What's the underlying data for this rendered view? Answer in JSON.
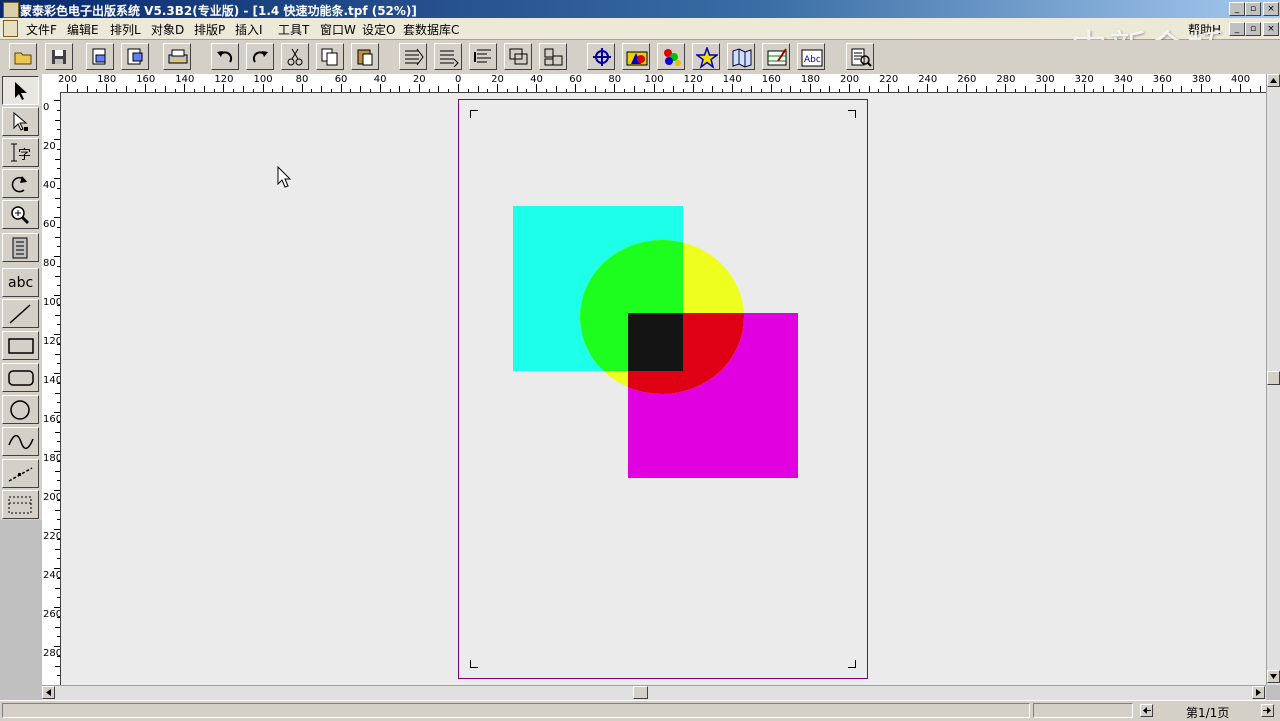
{
  "window": {
    "title": "蒙泰彩色电子出版系统 V5.3B2(专业版) - [1.4 快速功能条.tpf (52%)]",
    "help_menu": "帮助H"
  },
  "menu": [
    {
      "label": "文件F"
    },
    {
      "label": "编辑E"
    },
    {
      "label": "排列L"
    },
    {
      "label": "对象D"
    },
    {
      "label": "排版P"
    },
    {
      "label": "插入I"
    },
    {
      "label": "工具T"
    },
    {
      "label": "窗口W"
    },
    {
      "label": "设定O"
    },
    {
      "label": "套数据库C"
    }
  ],
  "watermark": "中新金桥",
  "toolbar": {
    "buttons": [
      "open-folder-icon",
      "save-disk-icon",
      "import-icon",
      "export-icon",
      "print-icon",
      "undo-icon",
      "redo-icon",
      "cut-icon",
      "copy-icon",
      "paste-icon",
      "bring-front-icon",
      "send-back-icon",
      "flow-text-icon",
      "group-icon",
      "ungroup-icon",
      "move-crosshair-icon",
      "color-shapes-icon",
      "color-palette-icon",
      "star-icon",
      "map-icon",
      "edit-table-icon",
      "abc-grid-icon",
      "preview-icon"
    ]
  },
  "palette": {
    "tools": [
      "arrow-select-icon",
      "node-select-icon",
      "text-tool-icon",
      "rotate-icon",
      "zoom-icon",
      "page-icon",
      "abc-text-icon",
      "line-icon",
      "rectangle-icon",
      "rounded-rect-icon",
      "ellipse-icon",
      "curve-icon",
      "dashed-line-icon",
      "table-frame-icon"
    ],
    "abc_label": "abc",
    "text_tool_label": "字"
  },
  "hruler": {
    "labels": [
      "200",
      "180",
      "160",
      "140",
      "120",
      "100",
      "80",
      "60",
      "40",
      "20",
      "0",
      "20",
      "40",
      "60",
      "80",
      "100",
      "120",
      "140",
      "160",
      "180",
      "200",
      "220",
      "240",
      "260",
      "280",
      "300",
      "320",
      "340",
      "360",
      "380",
      "400"
    ]
  },
  "vruler": {
    "labels": [
      "0",
      "20",
      "40",
      "60",
      "80",
      "100",
      "120",
      "140",
      "160",
      "180",
      "200",
      "220",
      "240",
      "260",
      "280"
    ]
  },
  "document": {
    "shapes": [
      {
        "name": "cyan-square",
        "color": "#1effea"
      },
      {
        "name": "magenta-square",
        "color": "#e000e0"
      },
      {
        "name": "yellow-circle",
        "color": "#eefe1e"
      },
      {
        "name": "green-overlap",
        "color": "#1efe1e"
      },
      {
        "name": "red-overlap",
        "color": "#e00014"
      },
      {
        "name": "black-overlap",
        "color": "#141414"
      }
    ]
  },
  "status": {
    "page": "第1/1页"
  }
}
